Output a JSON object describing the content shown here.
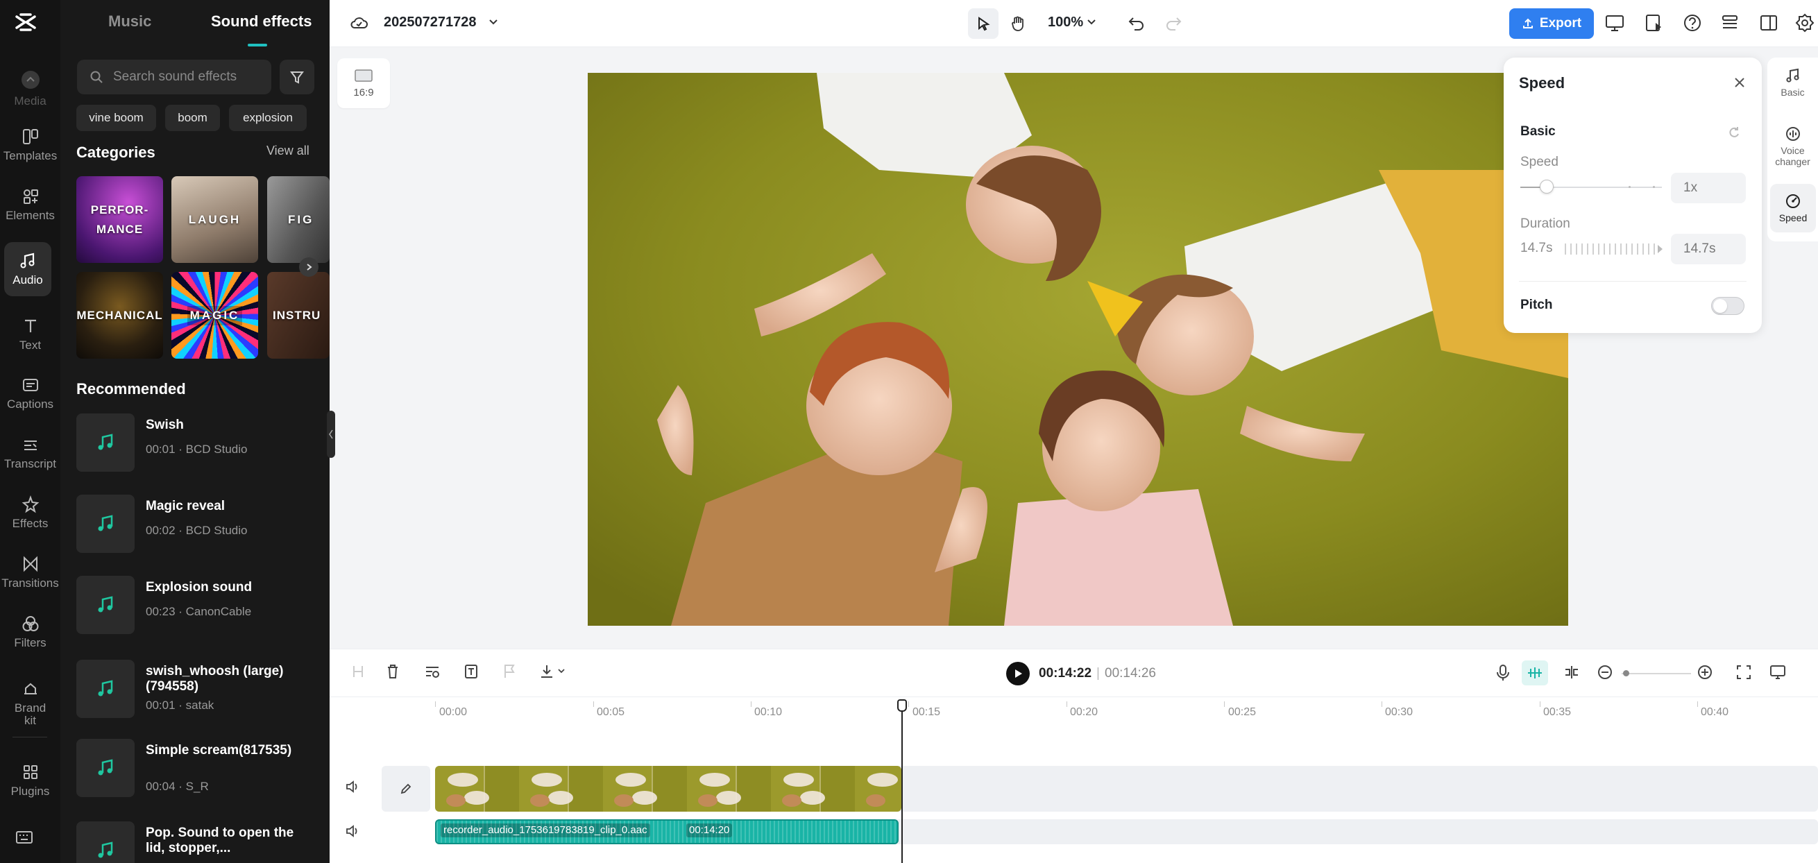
{
  "rail": {
    "items": [
      {
        "label": "Media",
        "icon": "media-icon"
      },
      {
        "label": "Templates",
        "icon": "templates-icon"
      },
      {
        "label": "Elements",
        "icon": "elements-icon"
      },
      {
        "label": "Audio",
        "icon": "audio-icon"
      },
      {
        "label": "Text",
        "icon": "text-icon"
      },
      {
        "label": "Captions",
        "icon": "captions-icon"
      },
      {
        "label": "Transcript",
        "icon": "transcript-icon"
      },
      {
        "label": "Effects",
        "icon": "effects-icon"
      },
      {
        "label": "Transitions",
        "icon": "transitions-icon"
      },
      {
        "label": "Filters",
        "icon": "filters-icon"
      },
      {
        "label": "Brand kit",
        "icon": "brand-kit-icon"
      },
      {
        "label": "Plugins",
        "icon": "plugins-icon"
      }
    ],
    "active": "Audio"
  },
  "panel": {
    "tabs": [
      "Music",
      "Sound effects"
    ],
    "active_tab": "Sound effects",
    "search_placeholder": "Search sound effects",
    "chips": [
      "vine boom",
      "boom",
      "explosion"
    ],
    "categories_title": "Categories",
    "view_all": "View all",
    "categories": [
      {
        "label": "PERFOR-\nMANCE"
      },
      {
        "label": "LAUGH"
      },
      {
        "label": "FIG"
      },
      {
        "label": "MECHANICAL"
      },
      {
        "label": "MAGIC"
      },
      {
        "label": "INSTRU"
      }
    ],
    "recommended_title": "Recommended",
    "tracks": [
      {
        "name": "Swish",
        "meta": "00:01 · BCD Studio"
      },
      {
        "name": "Magic reveal",
        "meta": "00:02 · BCD Studio"
      },
      {
        "name": "Explosion sound",
        "meta": "00:23 · CanonCable"
      },
      {
        "name": "swish_whoosh (large)(794558)",
        "meta": "00:01 · satak"
      },
      {
        "name": "Simple scream(817535)",
        "meta": "00:04 · S_R"
      },
      {
        "name": "Pop. Sound to open the lid, stopper,...",
        "meta": ""
      }
    ]
  },
  "topbar": {
    "project_name": "202507271728",
    "zoom": "100%",
    "export_label": "Export"
  },
  "canvas": {
    "ratio": "16:9"
  },
  "speed_panel": {
    "title": "Speed",
    "section": "Basic",
    "speed_label": "Speed",
    "speed_value": "1x",
    "duration_label": "Duration",
    "duration_left": "14.7s",
    "duration_value": "14.7s",
    "pitch_label": "Pitch",
    "pitch_on": false
  },
  "right_rail": {
    "items": [
      {
        "label": "Basic"
      },
      {
        "label": "Voice changer"
      },
      {
        "label": "Speed"
      }
    ],
    "active": "Speed"
  },
  "timeline": {
    "current_time": "00:14:22",
    "total_time": "00:14:26",
    "ticks": [
      "00:00",
      "00:05",
      "00:10",
      "00:15",
      "00:20",
      "00:25",
      "00:30",
      "00:35",
      "00:40"
    ],
    "audio_clip_name": "recorder_audio_1753619783819_clip_0.aac",
    "audio_clip_duration": "00:14:20"
  },
  "colors": {
    "accent": "#2f7ff0",
    "teal": "#19b4a6",
    "rail_bg": "#141414",
    "panel_bg": "#191919"
  }
}
